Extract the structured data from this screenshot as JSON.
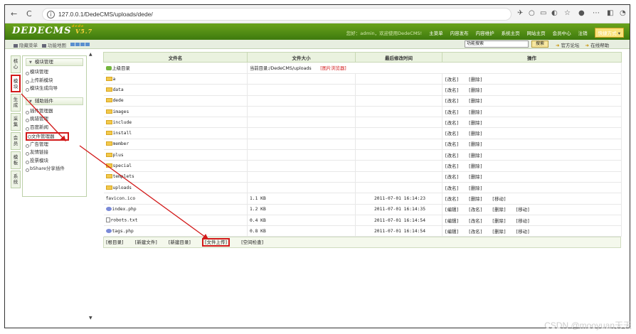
{
  "browser": {
    "url": "127.0.0.1/DedeCMS/uploads/dede/",
    "back": "←",
    "forward": "→",
    "reload": "C"
  },
  "header": {
    "logo": "DEDECMS",
    "version": "V5.7",
    "ddmark": "dede",
    "welcome": "您好：admin，欢迎使用DedeCMS!",
    "nav": [
      "主菜单",
      "内容发布",
      "内容维护",
      "系统主页",
      "网站主页",
      "会员中心",
      "注销"
    ],
    "quick": "快捷方式"
  },
  "subbar": {
    "hide_menu": "隐藏菜单",
    "feature_map": "功能地图",
    "search_placeholder": "功能搜索",
    "search_btn": "搜索",
    "forum": "官方论坛",
    "help": "在线帮助"
  },
  "vtabs": [
    "核心",
    "模块",
    "生成",
    "采集",
    "会员",
    "模板",
    "系统"
  ],
  "menu": {
    "group1": "模块管理",
    "group1_items": [
      "模块管理",
      "上传新模块",
      "模块生成向导"
    ],
    "group2": "辅助插件",
    "group2_items": [
      "插件管理器",
      "挑错管理",
      "百度新闻",
      "文件管理器",
      "广告管理",
      "友情链接",
      "投票模块",
      "bShare分享插件"
    ]
  },
  "table": {
    "headers": [
      "文件名",
      "文件大小",
      "最后修改时间",
      "操作"
    ],
    "up_label": "上级目录",
    "current_dir": "当前目录:/DedeCMS/uploads",
    "image_browser": "[图片浏览器]",
    "dirs": [
      "a",
      "data",
      "dede",
      "images",
      "include",
      "install",
      "member",
      "plus",
      "special",
      "templets",
      "uploads"
    ],
    "dir_actions": [
      "[改名]",
      "[删除]"
    ],
    "files": [
      {
        "name": "favicon.ico",
        "size": "1.1 KB",
        "time": "2011-07-01 16:14:23",
        "icon": "ico",
        "actions": [
          "[改名]",
          "[删除]",
          "[移动]"
        ]
      },
      {
        "name": "index.php",
        "size": "1.2 KB",
        "time": "2011-07-01 16:14:35",
        "icon": "php",
        "actions": [
          "[编辑]",
          "[改名]",
          "[删除]",
          "[移动]"
        ]
      },
      {
        "name": "robots.txt",
        "size": "0.4 KB",
        "time": "2011-07-01 16:14:54",
        "icon": "txt",
        "actions": [
          "[编辑]",
          "[改名]",
          "[删除]",
          "[移动]"
        ]
      },
      {
        "name": "tags.php",
        "size": "0.8 KB",
        "time": "2011-07-01 16:14:54",
        "icon": "php",
        "actions": [
          "[编辑]",
          "[改名]",
          "[删除]",
          "[移动]"
        ]
      }
    ],
    "bottom_links": [
      "[根目录]",
      "[新建文件]",
      "[新建目录]",
      "[文件上传]",
      "[空间检查]"
    ]
  },
  "watermark": "CSDN @mooyuan天天",
  "colors": {
    "header_green": "#4f8d16",
    "highlight_red": "#d21a1a",
    "quick_yellow": "#f9e27a"
  }
}
